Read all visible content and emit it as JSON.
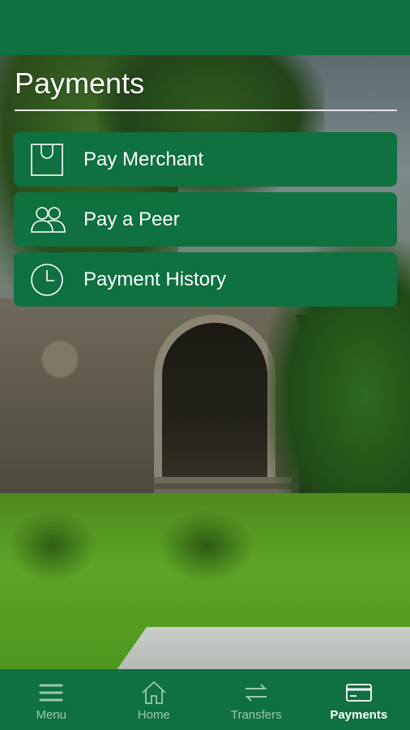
{
  "page": {
    "title": "Payments"
  },
  "menu": {
    "items": [
      {
        "label": "Pay Merchant",
        "icon": "shopping-bag-icon"
      },
      {
        "label": "Pay a Peer",
        "icon": "people-icon"
      },
      {
        "label": "Payment History",
        "icon": "clock-icon"
      }
    ]
  },
  "bottom_nav": {
    "items": [
      {
        "label": "Menu",
        "icon": "hamburger-menu-icon",
        "active": false
      },
      {
        "label": "Home",
        "icon": "home-icon",
        "active": false
      },
      {
        "label": "Transfers",
        "icon": "transfer-arrows-icon",
        "active": false
      },
      {
        "label": "Payments",
        "icon": "card-icon",
        "active": true
      }
    ]
  },
  "colors": {
    "brand_green": "#0f7040",
    "text_white": "#ffffff",
    "inactive_nav_text": "#9cc9ab"
  }
}
